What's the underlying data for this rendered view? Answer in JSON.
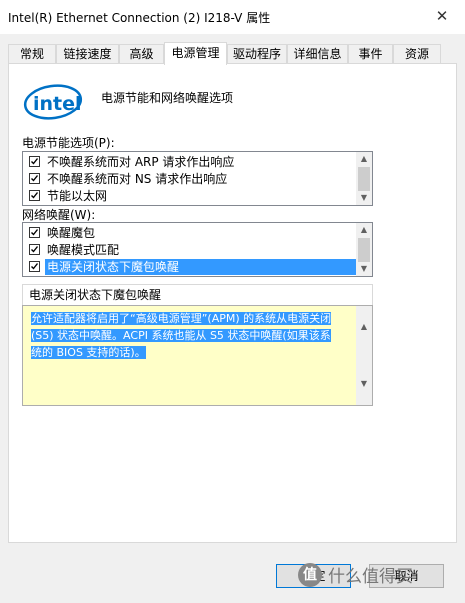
{
  "window": {
    "title": "Intel(R) Ethernet Connection (2) I218-V 属性",
    "close_glyph": "✕"
  },
  "tabs": [
    {
      "label": "常规"
    },
    {
      "label": "链接速度"
    },
    {
      "label": "高级"
    },
    {
      "label": "电源管理",
      "active": true
    },
    {
      "label": "驱动程序"
    },
    {
      "label": "详细信息"
    },
    {
      "label": "事件"
    },
    {
      "label": "资源"
    }
  ],
  "header": {
    "logo_text": "intel",
    "title": "电源节能和网络唤醒选项"
  },
  "power_saving": {
    "label": "电源节能选项(P):",
    "items": [
      {
        "label": "不唤醒系统而对 ARP 请求作出响应",
        "checked": true
      },
      {
        "label": "不唤醒系统而对 NS 请求作出响应",
        "checked": true
      },
      {
        "label": "节能以太网",
        "checked": true
      }
    ]
  },
  "wake_on_lan": {
    "label": "网络唤醒(W):",
    "items": [
      {
        "label": "唤醒魔包",
        "checked": true
      },
      {
        "label": "唤醒模式匹配",
        "checked": true
      },
      {
        "label": "电源关闭状态下魔包唤醒",
        "checked": true,
        "selected": true
      }
    ]
  },
  "description": {
    "title": "电源关闭状态下魔包唤醒",
    "lines": [
      "允许适配器将启用了“高级电源管理”(APM) 的系统从电源关闭",
      "(S5) 状态中唤醒。ACPI 系统也能从 S5 状态中唤醒(如果该系",
      "统的 BIOS 支持的话)。"
    ]
  },
  "buttons": {
    "ok_label": "确定",
    "cancel_label": "取消"
  },
  "watermark": {
    "text": "值  什么值得买",
    "logo_char": "值"
  },
  "colors": {
    "selection": "#3399ff",
    "description_bg": "#ffffc8",
    "intel_blue": "#0071c5"
  }
}
